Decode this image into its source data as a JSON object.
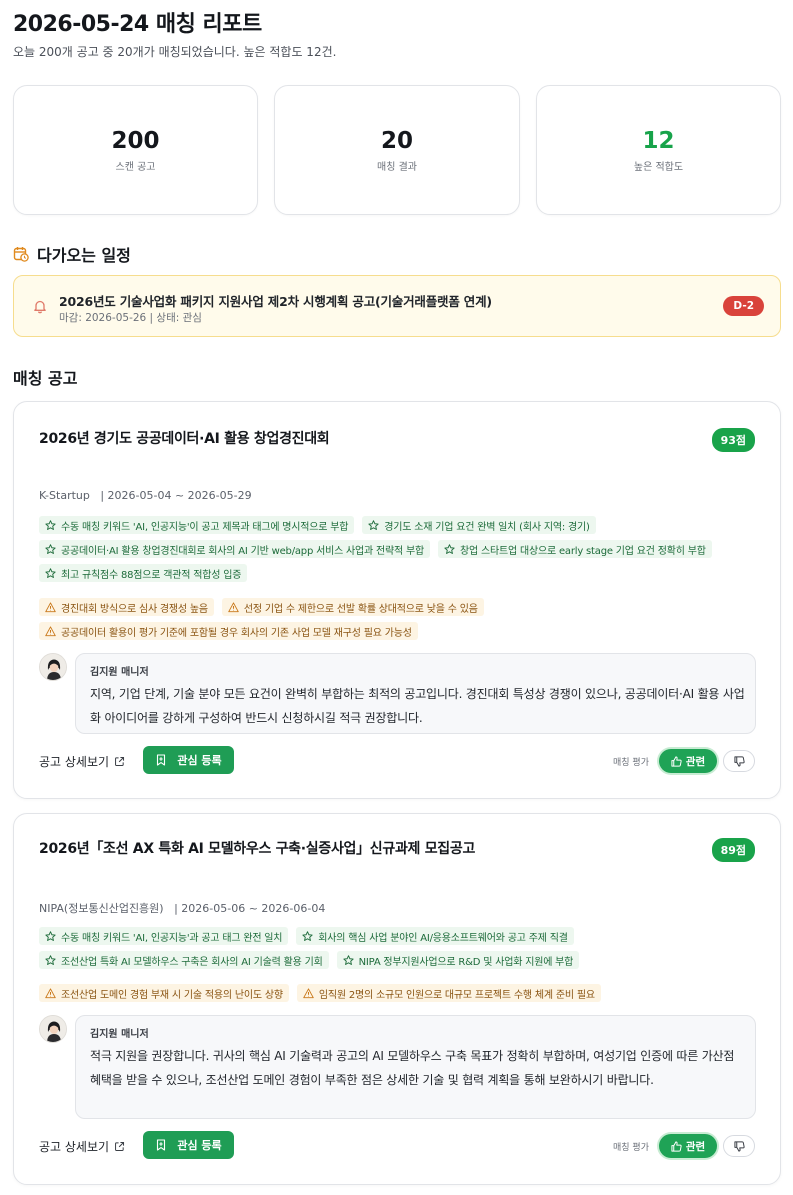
{
  "header": {
    "title": "2026-05-24 매칭 리포트",
    "subtitle": "오늘 200개 공고 중 20개가 매칭되었습니다. 높은 적합도 12건."
  },
  "stats": [
    {
      "value": "200",
      "label": "스캔 공고"
    },
    {
      "value": "20",
      "label": "매칭 결과"
    },
    {
      "value": "12",
      "label": "높은 적합도",
      "accent": "#17a34a"
    }
  ],
  "schedule": {
    "heading": "다가오는 일정",
    "icon": "calendar-clock-icon",
    "item": {
      "icon": "bell-icon",
      "title": "2026년도 기술사업화 패키지 지원사업 제2차 시행계획 공고(기술거래플랫폼 연계)",
      "meta": "마감: 2026-05-26 | 상태: 관심",
      "dday": "D-2"
    }
  },
  "matches": {
    "heading": "매칭 공고",
    "cards": [
      {
        "title": "2026년 경기도 공공데이터·AI 활용 창업경진대회",
        "score": "93점",
        "meta": "K-Startup   | 2026-05-04 ~ 2026-05-29",
        "strengths": [
          "수동 매칭 키워드 'AI, 인공지능'이 공고 제목과 태그에 명시적으로 부합",
          "경기도 소재 기업 요건 완벽 일치 (회사 지역: 경기)",
          "공공데이터·AI 활용 창업경진대회로 회사의 AI 기반 web/app 서비스 사업과 전략적 부합",
          "창업 스타트업 대상으로 early stage 기업 요건 정확히 부합",
          "최고 규칙점수 88점으로 객관적 적합성 입증"
        ],
        "risks": [
          "경진대회 방식으로 심사 경쟁성 높음",
          "선정 기업 수 제한으로 선발 확률 상대적으로 낮을 수 있음",
          "공공데이터 활용이 평가 기준에 포함될 경우 회사의 기존 사업 모델 재구성 필요 가능성"
        ],
        "advisor": "김지원 매니저",
        "comment": "지역, 기업 단계, 기술 분야 모든 요건이 완벽히 부합하는 최적의 공고입니다. 경진대회 특성상 경쟁이 있으나, 공공데이터·AI 활용 사업화 아이디어를 강하게 구성하여 반드시 신청하시길 적극 권장합니다.",
        "detail_label": "공고 상세보기",
        "fav_label": "관심 등록",
        "eval_label": "매칭 평가",
        "relevant_label": "관련"
      },
      {
        "title": "2026년「조선 AX 특화 AI 모델하우스 구축·실증사업」신규과제 모집공고",
        "score": "89점",
        "meta": "NIPA(정보통신산업진흥원)   | 2026-05-06 ~ 2026-06-04",
        "strengths": [
          "수동 매칭 키워드 'AI, 인공지능'과 공고 태그 완전 일치",
          "회사의 핵심 사업 분야인 AI/응용소프트웨어와 공고 주제 직결",
          "조선산업 특화 AI 모델하우스 구축은 회사의 AI 기술력 활용 기회",
          "NIPA 정부지원사업으로 R&D 및 사업화 지원에 부합"
        ],
        "risks": [
          "조선산업 도메인 경험 부재 시 기술 적용의 난이도 상향",
          "임직원 2명의 소규모 인원으로 대규모 프로젝트 수행 체계 준비 필요"
        ],
        "advisor": "김지원 매니저",
        "comment": "적극 지원을 권장합니다. 귀사의 핵심 AI 기술력과 공고의 AI 모델하우스 구축 목표가 정확히 부합하며, 여성기업 인증에 따른 가산점 혜택을 받을 수 있으나, 조선산업 도메인 경험이 부족한 점은 상세한 기술 및 협력 계획을 통해 보완하시기 바랍니다.",
        "detail_label": "공고 상세보기",
        "fav_label": "관심 등록",
        "eval_label": "매칭 평가",
        "relevant_label": "관련"
      }
    ]
  }
}
